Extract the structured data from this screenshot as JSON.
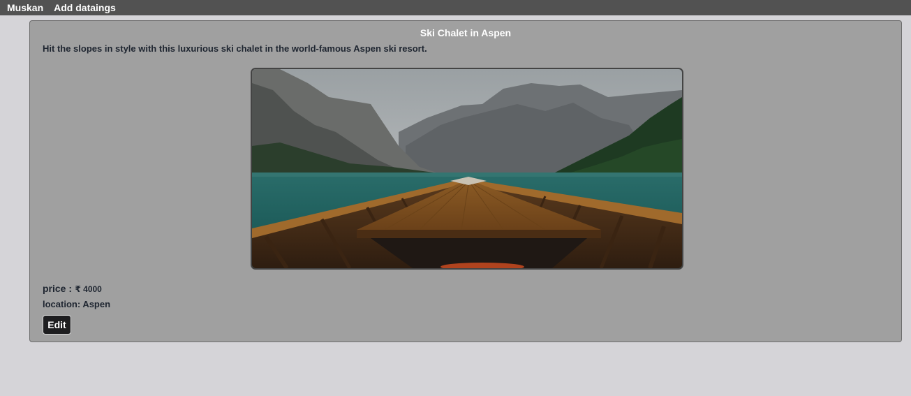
{
  "navbar": {
    "brand": "Muskan",
    "links": [
      {
        "label": "Add dataings"
      }
    ]
  },
  "listing": {
    "title": "Ski Chalet in Aspen",
    "description": "Hit the slopes in style with this luxurious ski chalet in the world-famous Aspen ski resort.",
    "price_label": "price :",
    "price_value": "₹ 4000",
    "location_label": "location:",
    "location_value": "Aspen",
    "edit_label": "Edit"
  },
  "colors": {
    "navbar_bg": "#525252",
    "page_bg": "#d5d4d8",
    "card_bg": "#a0a0a0",
    "button_bg": "#1e1e20"
  }
}
